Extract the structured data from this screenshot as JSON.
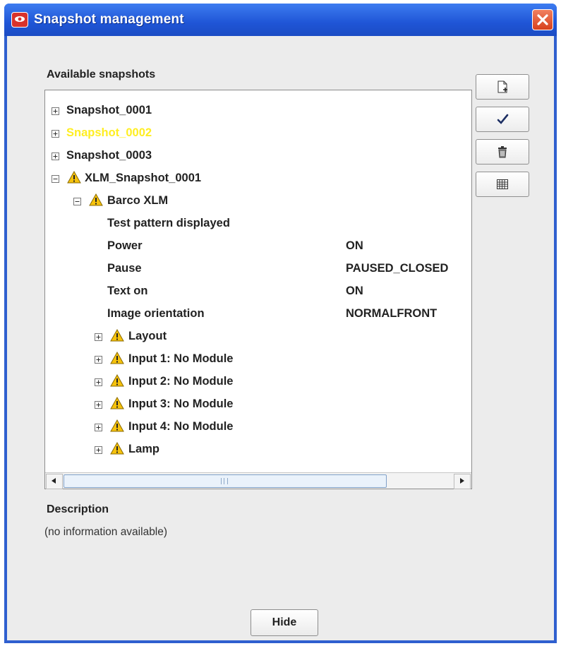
{
  "window": {
    "title": "Snapshot management"
  },
  "labels": {
    "available": "Available snapshots",
    "description": "Description"
  },
  "description": {
    "text": "(no information available)"
  },
  "buttons": {
    "hide": "Hide"
  },
  "toolbar": {
    "icons": [
      "new-snapshot-icon",
      "apply-check-icon",
      "delete-trash-icon",
      "grid-view-icon"
    ]
  },
  "colors": {
    "highlight": "#ffee22",
    "titlebar": "#2f5fcf",
    "warning": "#f6c20c"
  },
  "tree": {
    "nodes": [
      {
        "label": "Snapshot_0001",
        "value": ""
      },
      {
        "label": "Snapshot_0002",
        "value": ""
      },
      {
        "label": "Snapshot_0003",
        "value": ""
      },
      {
        "label": "XLM_Snapshot_0001",
        "value": ""
      },
      {
        "label": "Barco XLM",
        "value": ""
      },
      {
        "label": "Test pattern displayed",
        "value": ""
      },
      {
        "label": "Power",
        "value": "ON"
      },
      {
        "label": "Pause",
        "value": "PAUSED_CLOSED"
      },
      {
        "label": "Text on",
        "value": "ON"
      },
      {
        "label": "Image orientation",
        "value": "NORMALFRONT"
      },
      {
        "label": "Layout",
        "value": ""
      },
      {
        "label": "Input 1: No Module",
        "value": ""
      },
      {
        "label": "Input 2: No Module",
        "value": ""
      },
      {
        "label": "Input 3: No Module",
        "value": ""
      },
      {
        "label": "Input 4: No Module",
        "value": ""
      },
      {
        "label": "Lamp",
        "value": ""
      }
    ]
  }
}
